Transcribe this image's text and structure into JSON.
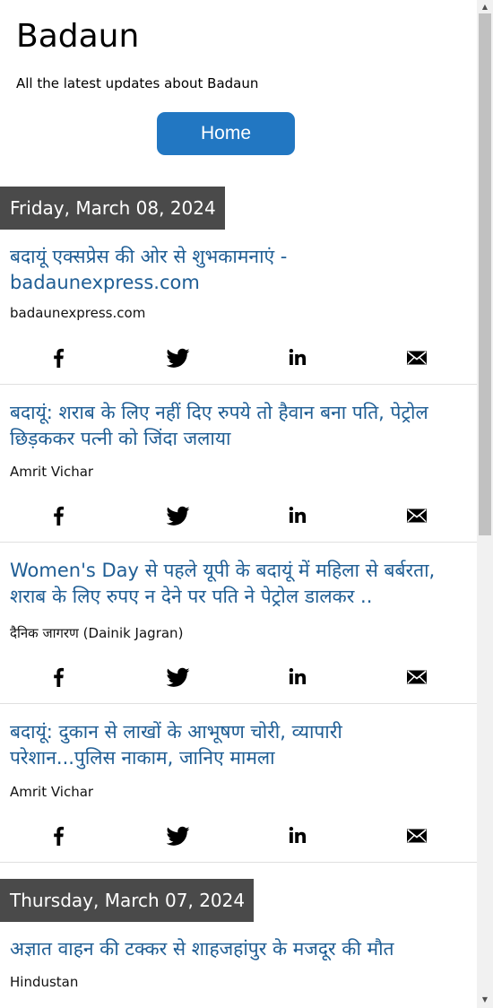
{
  "header": {
    "site_title": "Badaun",
    "site_description": "All the latest updates about Badaun",
    "home_label": "Home"
  },
  "dates": [
    "Friday, March 08, 2024",
    "Thursday, March 07, 2024"
  ],
  "articles": [
    {
      "headline": "बदायूं एक्सप्रेस की ओर से शुभकामनाएं - badaunexpress.com",
      "source": "badaunexpress.com"
    },
    {
      "headline": "बदायूं: शराब के लिए नहीं दिए रुपये तो हैवान बना पति, पेट्रोल छिड़ककर पत्नी को जिंदा जलाया",
      "source": "Amrit Vichar"
    },
    {
      "headline": "Women's Day से पहले यूपी के बदायूं में महिला से बर्बरता, शराब के लिए रुपए न देने पर पति ने पेट्रोल डालकर ..",
      "source": "दैनिक जागरण (Dainik Jagran)"
    },
    {
      "headline": "बदायूं: दुकान से लाखों के आभूषण चोरी, व्यापारी परेशान...पुलिस नाकाम, जानिए मामला",
      "source": "Amrit Vichar"
    },
    {
      "headline": "अज्ञात वाहन की टक्कर से शाहजहांपुर के मजदूर की मौत",
      "source": "Hindustan"
    }
  ],
  "share_icons": [
    "facebook-icon",
    "twitter-icon",
    "linkedin-icon",
    "email-icon"
  ],
  "colors": {
    "link": "#1e5d94",
    "button": "#2277c2",
    "date_bar": "#4a4a4a"
  }
}
